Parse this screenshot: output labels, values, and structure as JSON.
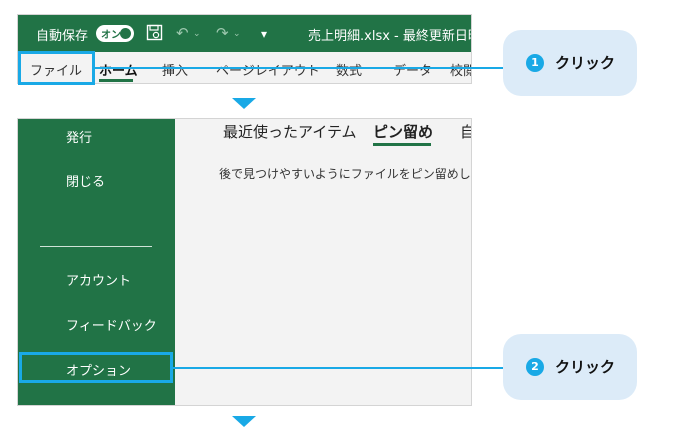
{
  "ribbon": {
    "autosave_label": "自動保存",
    "autosave_state": "オン",
    "document_title": "売上明細.xlsx - 最終更新日時",
    "tabs": [
      "ファイル",
      "ホーム",
      "挿入",
      "ページレイアウト",
      "数式",
      "データ",
      "校閲"
    ],
    "active_tab": "ホーム",
    "accent_color": "#217346"
  },
  "backstage": {
    "side_items": {
      "publish": "発行",
      "close": "閉じる",
      "account": "アカウント",
      "feedback": "フィードバック",
      "options": "オプション"
    },
    "content_tabs": [
      "最近使ったアイテム",
      "ピン留め",
      "自"
    ],
    "active_content_tab": "ピン留め",
    "description": "後で見つけやすいようにファイルをピン留めします。"
  },
  "callouts": [
    {
      "number": "1",
      "text": "クリック"
    },
    {
      "number": "2",
      "text": "クリック"
    }
  ],
  "highlight_color": "#19a9e6"
}
